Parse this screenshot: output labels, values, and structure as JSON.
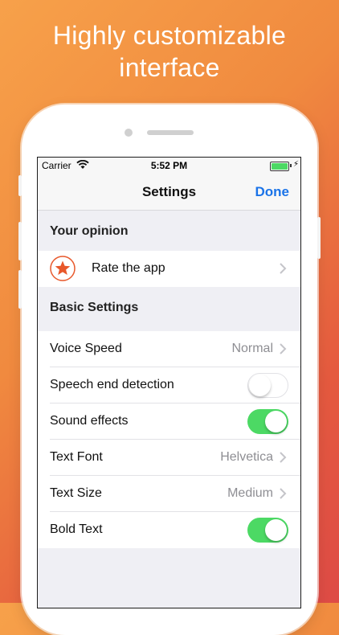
{
  "headline": {
    "line1": "Highly customizable",
    "line2": "interface"
  },
  "status_bar": {
    "carrier": "Carrier",
    "time": "5:52 PM",
    "wifi_icon": "wifi-icon",
    "battery_icon": "battery-charging-icon",
    "battery_level": 1.0
  },
  "nav": {
    "title": "Settings",
    "done_label": "Done"
  },
  "sections": {
    "opinion_header": "Your opinion",
    "basic_header": "Basic Settings"
  },
  "rows": {
    "rate": {
      "label": "Rate the app",
      "icon": "star-icon"
    },
    "voice_speed": {
      "label": "Voice Speed",
      "value": "Normal"
    },
    "speech_end": {
      "label": "Speech end detection",
      "on": false
    },
    "sound_effects": {
      "label": "Sound effects",
      "on": true
    },
    "text_font": {
      "label": "Text Font",
      "value": "Helvetica"
    },
    "text_size": {
      "label": "Text Size",
      "value": "Medium"
    },
    "bold_text": {
      "label": "Bold Text",
      "on": true
    }
  },
  "colors": {
    "accent": "#1a73e8",
    "toggle_on": "#4cd964",
    "star": "#e8582b",
    "background_from": "#f7a14a",
    "background_to": "#de4b46"
  }
}
